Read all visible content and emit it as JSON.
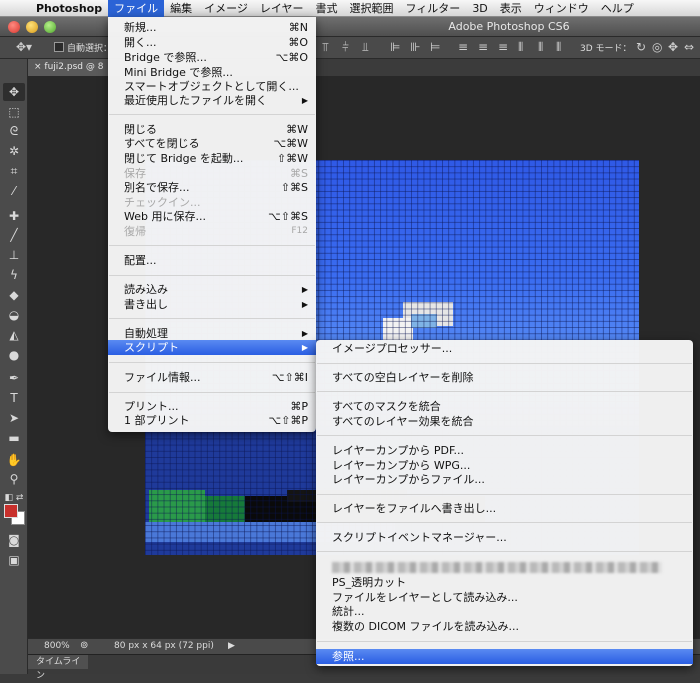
{
  "menubar": {
    "app_name": "Photoshop",
    "items": [
      "ファイル",
      "編集",
      "イメージ",
      "レイヤー",
      "書式",
      "選択範囲",
      "フィルター",
      "3D",
      "表示",
      "ウィンドウ",
      "ヘルプ"
    ]
  },
  "window": {
    "title": "Adobe Photoshop CS6"
  },
  "options_bar": {
    "auto_select_label": "自動選択：",
    "mode_label": "3D モード："
  },
  "document": {
    "tab_title": "fuji2.psd @ 8",
    "zoom": "800%",
    "info": "80 px x 64 px (72 ppi)"
  },
  "timeline": {
    "tab_label": "タイムライン"
  },
  "file_menu": {
    "items": [
      {
        "label": "新規...",
        "shortcut": "⌘N"
      },
      {
        "label": "開く...",
        "shortcut": "⌘O"
      },
      {
        "label": "Bridge で参照...",
        "shortcut": "⌥⌘O"
      },
      {
        "label": "Mini Bridge で参照...",
        "shortcut": ""
      },
      {
        "label": "スマートオブジェクトとして開く...",
        "shortcut": ""
      },
      {
        "label": "最近使用したファイルを開く",
        "shortcut": ""
      },
      {
        "label": "閉じる",
        "shortcut": "⌘W"
      },
      {
        "label": "すべてを閉じる",
        "shortcut": "⌥⌘W"
      },
      {
        "label": "閉じて Bridge を起動...",
        "shortcut": "⇧⌘W"
      },
      {
        "label": "保存",
        "shortcut": "⌘S"
      },
      {
        "label": "別名で保存...",
        "shortcut": "⇧⌘S"
      },
      {
        "label": "チェックイン...",
        "shortcut": ""
      },
      {
        "label": "Web 用に保存...",
        "shortcut": "⌥⇧⌘S"
      },
      {
        "label": "復帰",
        "shortcut": "F12"
      },
      {
        "label": "配置...",
        "shortcut": ""
      },
      {
        "label": "読み込み",
        "shortcut": ""
      },
      {
        "label": "書き出し",
        "shortcut": ""
      },
      {
        "label": "自動処理",
        "shortcut": ""
      },
      {
        "label": "スクリプト",
        "shortcut": ""
      },
      {
        "label": "ファイル情報...",
        "shortcut": "⌥⇧⌘I"
      },
      {
        "label": "プリント...",
        "shortcut": "⌘P"
      },
      {
        "label": "1 部プリント",
        "shortcut": "⌥⇧⌘P"
      }
    ]
  },
  "script_menu": {
    "items": [
      "イメージプロセッサー...",
      "すべての空白レイヤーを削除",
      "すべてのマスクを統合",
      "すべてのレイヤー効果を統合",
      "レイヤーカンプから PDF...",
      "レイヤーカンプから WPG...",
      "レイヤーカンプからファイル...",
      "レイヤーをファイルへ書き出し...",
      "スクリプトイベントマネージャー...",
      "PS_透明カット",
      "ファイルをレイヤーとして読み込み...",
      "統計...",
      "複数の DICOM ファイルを読み込み...",
      "参照..."
    ]
  },
  "colors": {
    "highlight": "#2a5ee3",
    "menubar_active": "#2b63d6",
    "foreground_swatch": "#c8302c",
    "background_swatch": "#ffffff"
  }
}
